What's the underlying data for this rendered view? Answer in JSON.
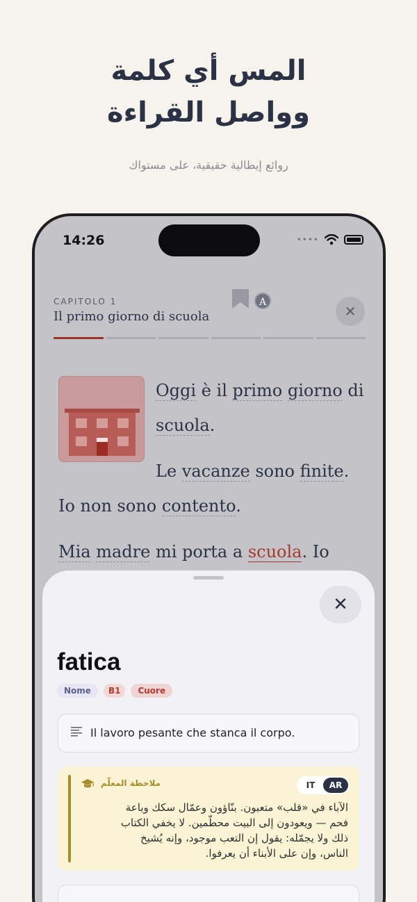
{
  "promo": {
    "headline_line1": "المس أي كلمة",
    "headline_line2": "وواصل القراءة",
    "subline": "روائع إيطالية حقيقية، على مستواك"
  },
  "status_bar": {
    "time": "14:26",
    "dots": "••••"
  },
  "reader": {
    "chapter_label": "CAPITOLO 1",
    "chapter_title": "Il primo giorno di scuola",
    "font_button": "A",
    "close_label": "✕",
    "progress_segments": 6,
    "progress_active": 1,
    "accent_color": "#9c3328",
    "paragraphs": [
      {
        "w1": "Oggi",
        "t1": " è il ",
        "w2": "primo",
        "t2": " ",
        "w3": "giorno",
        "t3": " di ",
        "w4": "scuola",
        "t4": "."
      },
      {
        "t1": "Le ",
        "w1": "vacanze",
        "t2": " sono ",
        "w2": "finite",
        "t3": ". Io non sono ",
        "w3": "contento",
        "t4": "."
      },
      {
        "w1": "Mia",
        "t1": " ",
        "w2": "madre",
        "t2": " mi porta a ",
        "hl": "scuola",
        "t3": ". Io"
      }
    ]
  },
  "sheet": {
    "close_label": "✕",
    "word": "fatica",
    "tags": {
      "pos": "Nome",
      "level": "B1",
      "source": "Cuore"
    },
    "definition": "Il lavoro pesante che stanca il corpo.",
    "teacher_note": {
      "title": "ملاحظة المعلّم",
      "toggle": {
        "it": "IT",
        "ar": "AR",
        "selected": "AR"
      },
      "line1": "الآباء في «قلب» متعبون. بنّاؤون وعمّال سكك وباعة",
      "line2": "فحم — ويعودون إلى البيت محطّمين. لا يخفي الكتاب",
      "line3": "ذلك ولا يجمّله: يقول إن التعب موجود، وإنه يُشيخ",
      "line4": "الناس، وإن على الأبناء أن يعرفوا."
    }
  }
}
